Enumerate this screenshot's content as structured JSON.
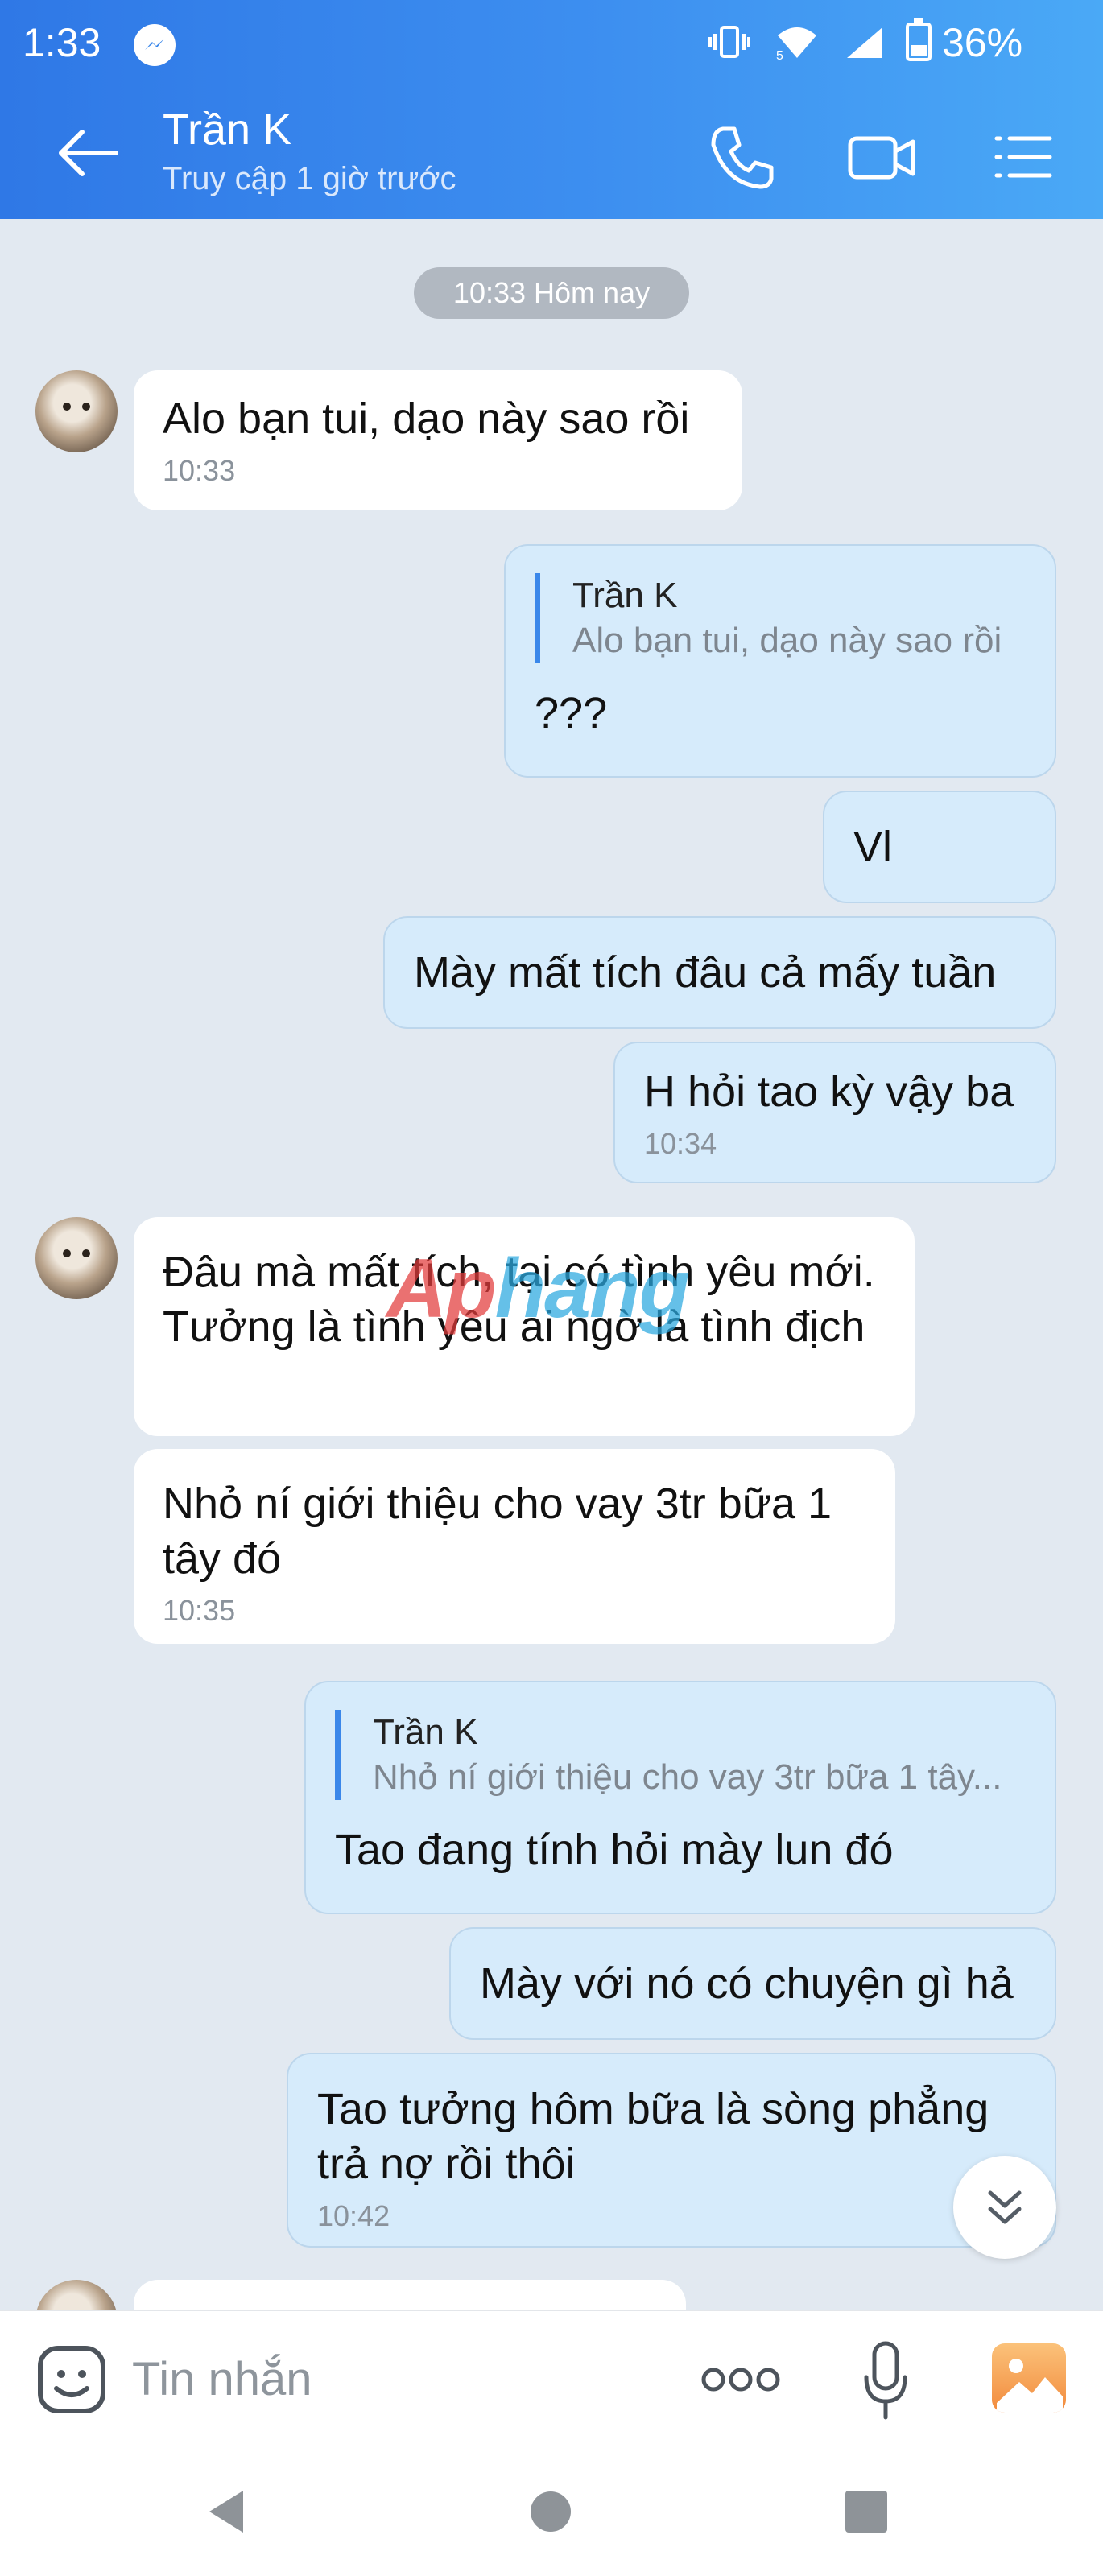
{
  "status_bar": {
    "time": "1:33",
    "battery": "36%",
    "network": "5"
  },
  "header": {
    "contact_name": "Trần K",
    "last_seen": "Truy cập 1 giờ trước"
  },
  "icons": {
    "back": "arrow-left-icon",
    "call": "phone-icon",
    "video": "video-camera-icon",
    "menu": "list-menu-icon",
    "emoji": "sticker-smile-icon",
    "more": "more-dots-icon",
    "mic": "microphone-icon",
    "gallery": "image-icon",
    "scroll": "chevron-double-down-icon"
  },
  "chat": {
    "date_label": "10:33 Hôm nay",
    "messages": [
      {
        "text": "Alo bạn tui, dạo này sao rồi",
        "time": "10:33"
      },
      {
        "quote_name": "Trần K",
        "quote_text": "Alo bạn tui, dạo này sao rồi",
        "text": "???"
      },
      {
        "text": "Vl"
      },
      {
        "text": "Mày mất tích đâu cả mấy tuần"
      },
      {
        "text": "H hỏi tao kỳ vậy ba",
        "time": "10:34"
      },
      {
        "text": "Đâu mà mất tích, tại có tình yêu mới. Tưởng là tình yêu ai ngờ là tình địch"
      },
      {
        "text": "Nhỏ ní giới thiệu cho vay 3tr bữa 1 tây đó",
        "time": "10:35"
      },
      {
        "quote_name": "Trần K",
        "quote_text": "Nhỏ ní giới thiệu cho vay 3tr bữa 1 tây...",
        "text": "Tao đang tính hỏi mày lun đó"
      },
      {
        "text": "Mày với nó có chuyện gì hả"
      },
      {
        "text": "Tao tưởng hôm bữa là sòng phẳng trả nợ rồi thôi",
        "time": "10:42"
      }
    ]
  },
  "watermark": {
    "part1": "Ap",
    "part2": "hang"
  },
  "composer": {
    "placeholder": "Tin nhắn"
  },
  "colors": {
    "header_start": "#2f78e6",
    "header_end": "#4aa9f6",
    "chat_bg": "#e2e9f1",
    "outgoing": "#d6ebfb",
    "accent": "#3a87ea"
  }
}
